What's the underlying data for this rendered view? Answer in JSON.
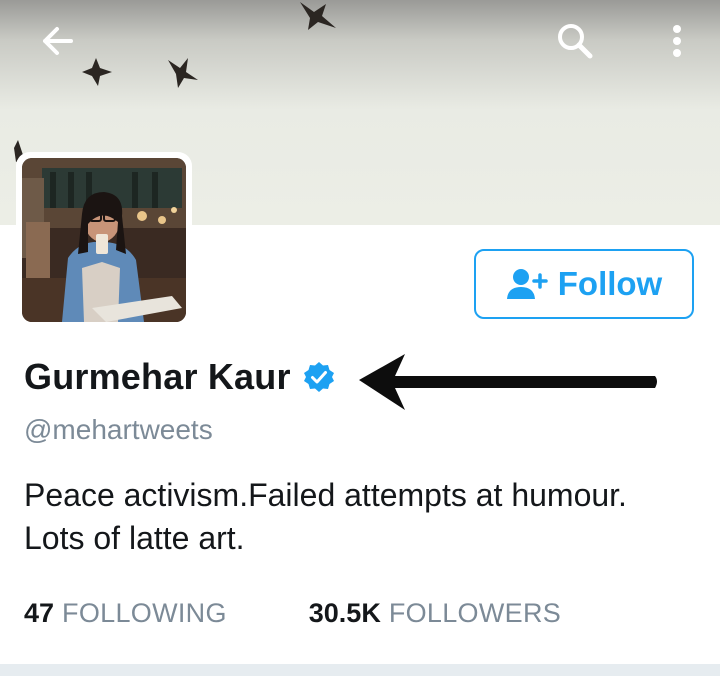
{
  "header": {
    "back_icon": "back-arrow-icon",
    "search_icon": "search-icon",
    "more_icon": "more-vertical-icon"
  },
  "profile": {
    "name": "Gurmehar Kaur",
    "verified": true,
    "handle": "@mehartweets",
    "bio": "Peace activism.Failed attempts at humour. Lots of latte art."
  },
  "follow_button": {
    "label": "Follow",
    "icon": "add-user-icon"
  },
  "stats": {
    "following_count": "47",
    "following_label": "FOLLOWING",
    "followers_count": "30.5K",
    "followers_label": "FOLLOWERS"
  },
  "colors": {
    "accent": "#1da1f2",
    "secondary_text": "#7c8a97",
    "primary_text": "#14171a"
  }
}
